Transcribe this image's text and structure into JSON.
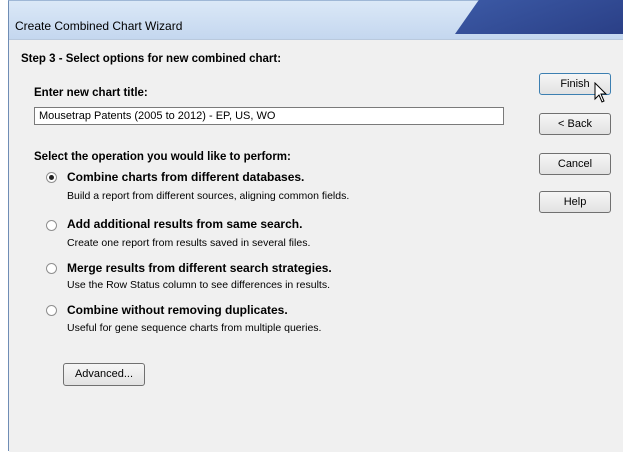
{
  "window": {
    "title": "Create Combined Chart Wizard"
  },
  "step_heading": "Step 3 - Select options for new combined chart:",
  "chart_title": {
    "label": "Enter new chart title:",
    "value": "Mousetrap Patents (2005 to 2012) - EP, US, WO"
  },
  "operation": {
    "label": "Select the operation you would like to perform:",
    "options": [
      {
        "title": "Combine charts from different databases.",
        "desc": "Build a report from different sources, aligning common fields.",
        "checked": true
      },
      {
        "title": "Add additional results from same search.",
        "desc": "Create one report from results saved in several files.",
        "checked": false
      },
      {
        "title": "Merge results from different search strategies.",
        "desc": "Use the Row Status column to see differences in results.",
        "checked": false
      },
      {
        "title": "Combine without removing duplicates.",
        "desc": "Useful for gene sequence charts from multiple queries.",
        "checked": false
      }
    ]
  },
  "buttons": {
    "finish": "Finish",
    "back": "< Back",
    "cancel": "Cancel",
    "help": "Help",
    "advanced": "Advanced..."
  },
  "icons": {
    "cursor": "mouse-pointer-icon"
  }
}
